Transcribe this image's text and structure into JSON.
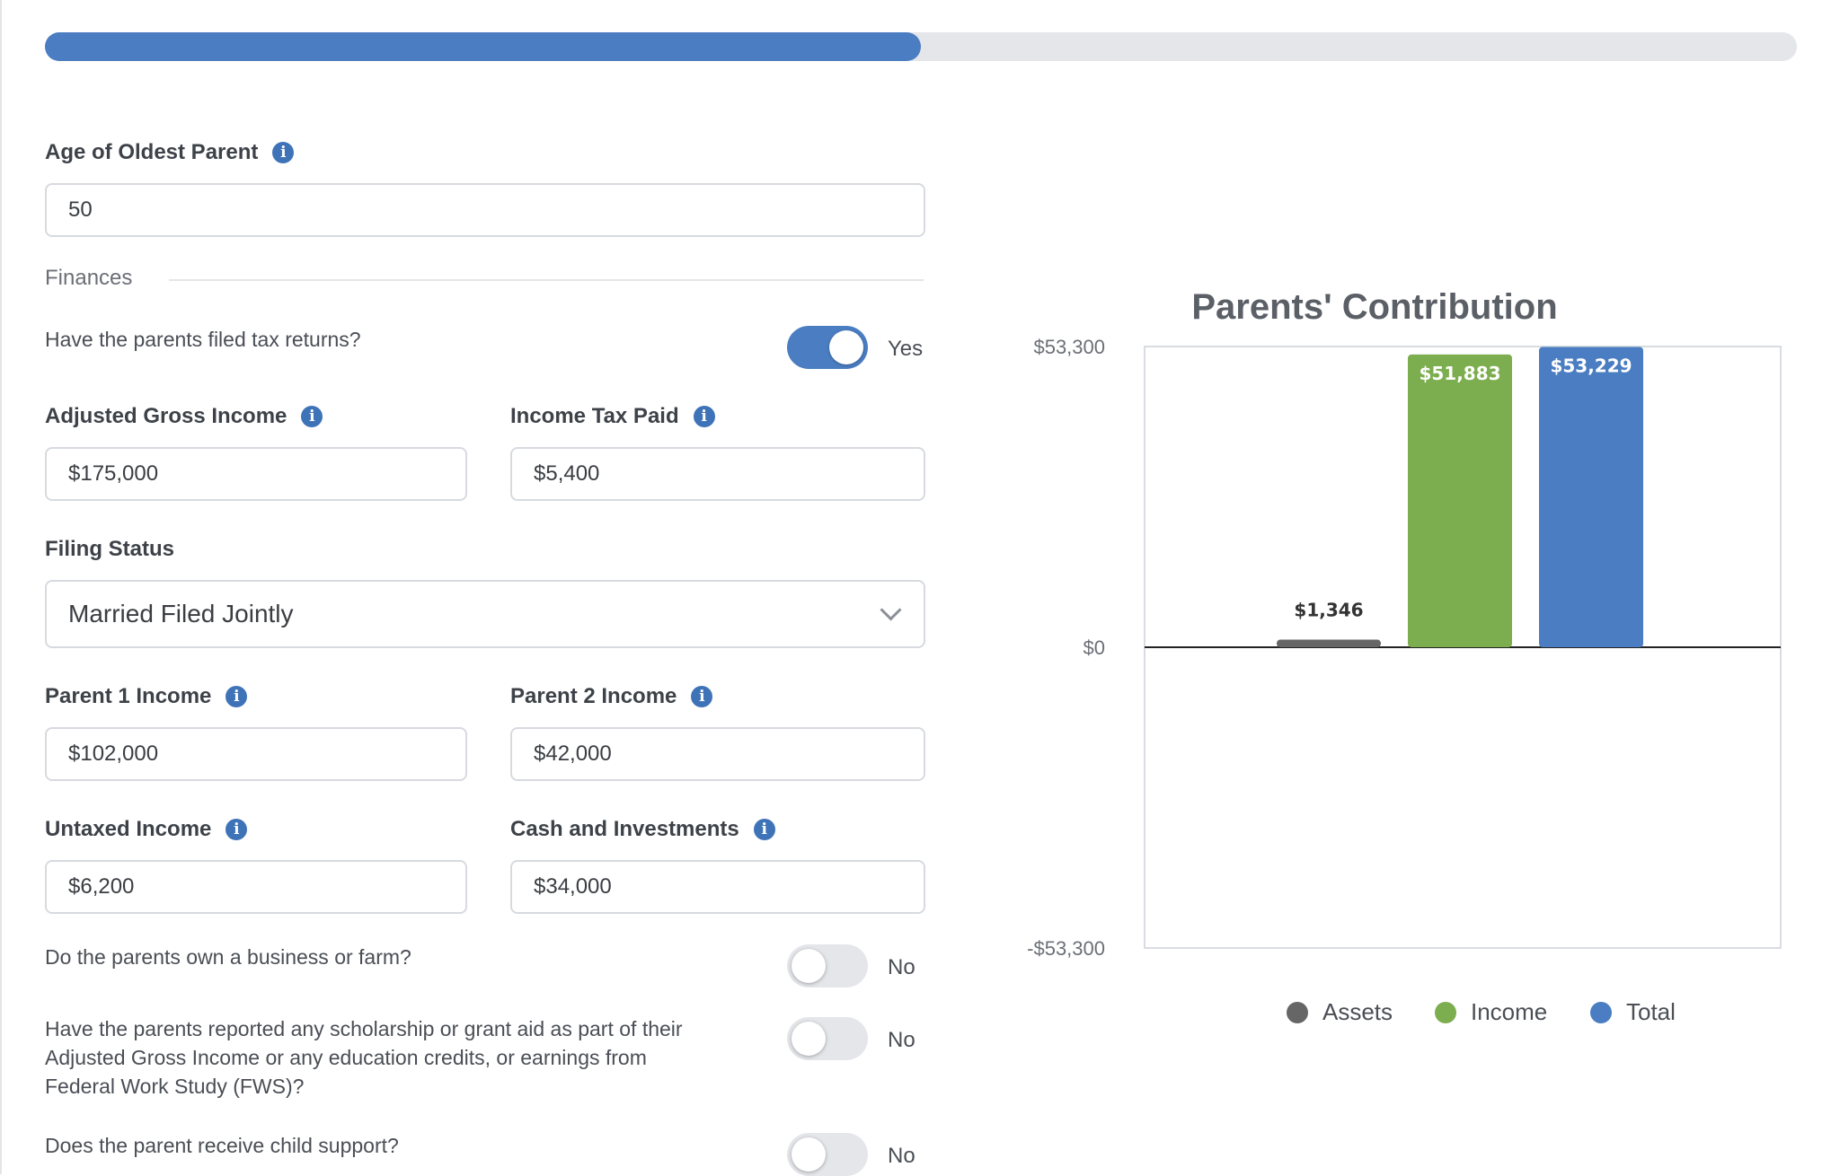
{
  "progress": {
    "percent": 50
  },
  "form": {
    "age": {
      "label": "Age of Oldest Parent",
      "value": "50"
    },
    "finances_section": "Finances",
    "filed_taxes": {
      "question": "Have the parents filed tax returns?",
      "state": "Yes"
    },
    "agi": {
      "label": "Adjusted Gross Income",
      "value": "$175,000"
    },
    "tax_paid": {
      "label": "Income Tax Paid",
      "value": "$5,400"
    },
    "filing_status": {
      "label": "Filing Status",
      "value": "Married Filed Jointly"
    },
    "parent1": {
      "label": "Parent 1 Income",
      "value": "$102,000"
    },
    "parent2": {
      "label": "Parent 2 Income",
      "value": "$42,000"
    },
    "untaxed": {
      "label": "Untaxed Income",
      "value": "$6,200"
    },
    "cash": {
      "label": "Cash and Investments",
      "value": "$34,000"
    },
    "business": {
      "question": "Do the parents own a business or farm?",
      "state": "No"
    },
    "scholarship": {
      "question": "Have the parents reported any scholarship or grant aid as part of their Adjusted Gross Income or any education credits, or earnings from Federal Work Study (FWS)?",
      "state": "No"
    },
    "child_support": {
      "question": "Does the parent receive child support?",
      "state": "No"
    }
  },
  "chart_data": {
    "type": "bar",
    "title": "Parents' Contribution",
    "categories": [
      "Assets",
      "Income",
      "Total"
    ],
    "values": [
      1346,
      51883,
      53229
    ],
    "value_labels": [
      "$1,346",
      "$51,883",
      "$53,229"
    ],
    "colors": [
      "#666666",
      "#7cad4e",
      "#4a7dc1"
    ],
    "ylim": [
      -53300,
      53300
    ],
    "yticks": [
      53300,
      0,
      -53300
    ],
    "ytick_labels": [
      "$53,300",
      "$0",
      "-$53,300"
    ],
    "legend": "bottom"
  }
}
